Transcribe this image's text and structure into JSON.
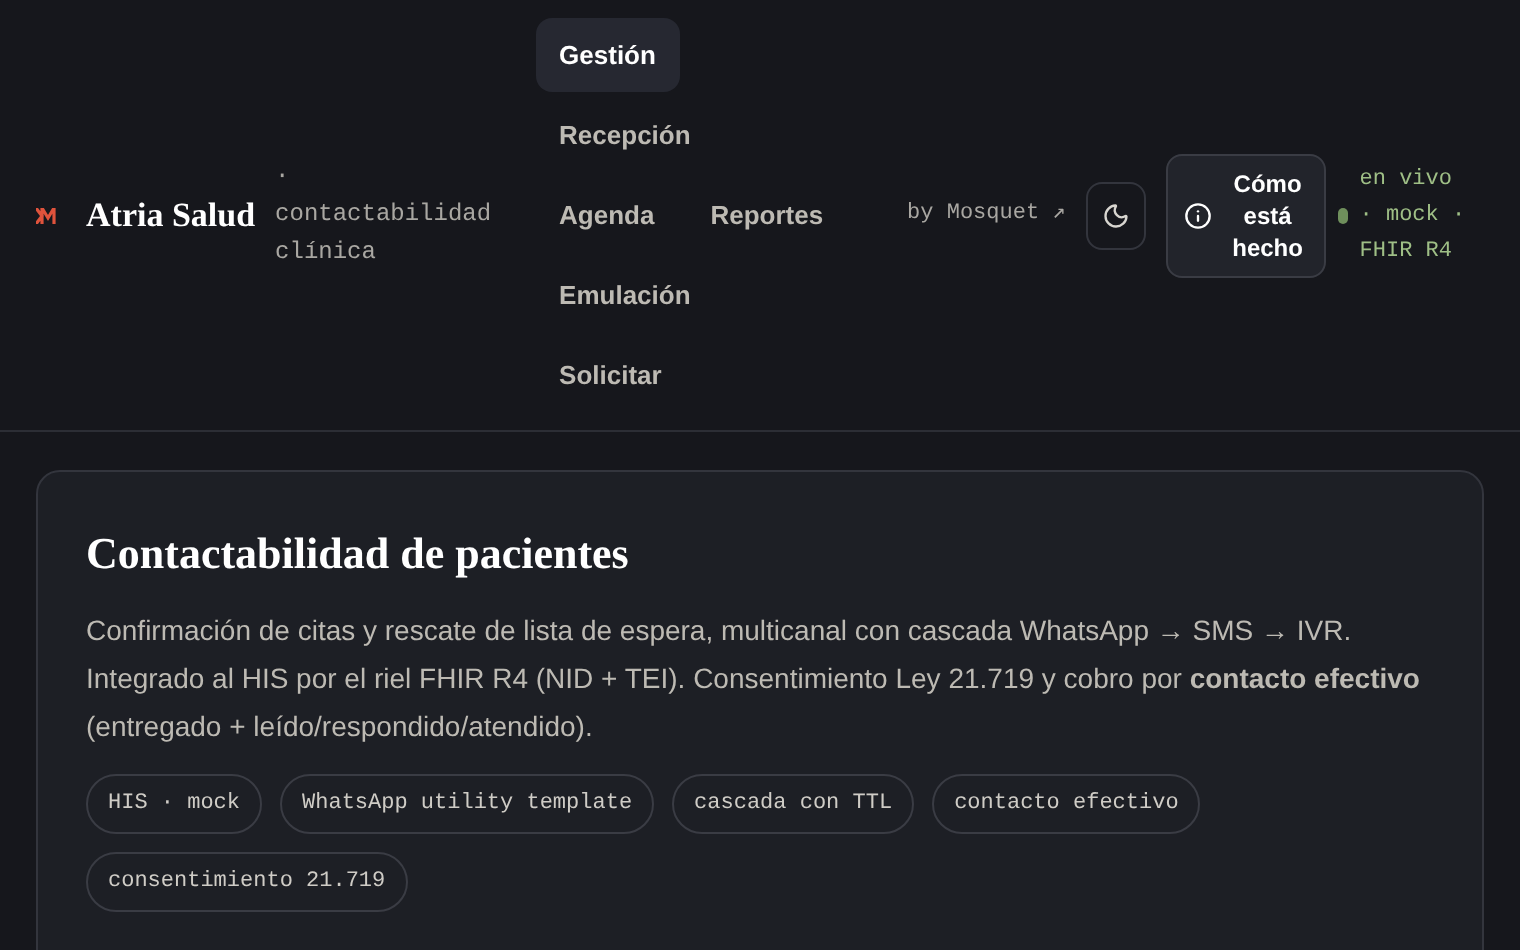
{
  "brand": {
    "name": "Atria Salud",
    "tagline": "· contactabilidad clínica"
  },
  "nav_rows": [
    [
      {
        "label": "Gestión",
        "selected": true
      }
    ],
    [
      {
        "label": "Recepción",
        "selected": false
      }
    ],
    [
      {
        "label": "Agenda",
        "selected": false
      },
      {
        "label": "Reportes",
        "selected": false
      }
    ],
    [
      {
        "label": "Emulación",
        "selected": false
      }
    ],
    [
      {
        "label": "Solicitar",
        "selected": false
      }
    ]
  ],
  "credit": "by Mosquet ↗",
  "how_button": "Cómo está hecho",
  "status": "en vivo · mock · FHIR R4",
  "card": {
    "title": "Contactabilidad de pacientes",
    "description": "Confirmación de citas y rescate de lista de espera, multicanal con cascada WhatsApp → SMS → IVR. Integrado al HIS por el riel FHIR R4 (NID + TEI). Consentimiento Ley 21.719 y cobro por **contacto efectivo** (entregado + leído/respondido/atendido).",
    "tags": [
      "HIS · mock",
      "WhatsApp utility template",
      "cascada con TTL",
      "contacto efectivo",
      "consentimiento 21.719"
    ]
  }
}
